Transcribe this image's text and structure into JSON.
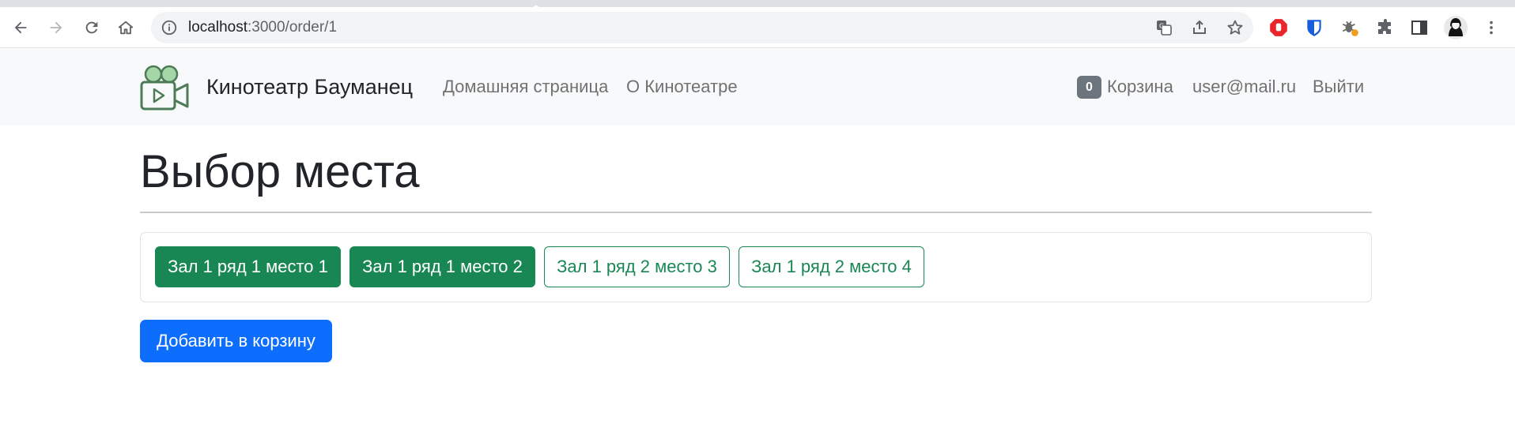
{
  "browser": {
    "url_host": "localhost",
    "url_path": ":3000/order/1"
  },
  "navbar": {
    "brand": "Кинотеатр Бауманец",
    "links": [
      "Домашняя страница",
      "О Кинотеатре"
    ],
    "cart_count": "0",
    "cart_label": "Корзина",
    "user_email": "user@mail.ru",
    "logout_label": "Выйти"
  },
  "page": {
    "title": "Выбор места",
    "seats": [
      {
        "label": "Зал 1 ряд 1 место 1",
        "selected": true
      },
      {
        "label": "Зал 1 ряд 1 место 2",
        "selected": true
      },
      {
        "label": "Зал 1 ряд 2 место 3",
        "selected": false
      },
      {
        "label": "Зал 1 ряд 2 место 4",
        "selected": false
      }
    ],
    "add_to_cart_label": "Добавить в корзину"
  },
  "colors": {
    "success": "#198754",
    "primary": "#0d6efd",
    "badge": "#6c757d",
    "navbar_bg": "#f8f9fa"
  },
  "icons": [
    "back-icon",
    "forward-icon",
    "reload-icon",
    "home-icon",
    "info-icon",
    "translate-icon",
    "share-icon",
    "bookmark-star-icon",
    "adblock-extension-icon",
    "bitwarden-extension-icon",
    "bug-extension-icon",
    "extensions-puzzle-icon",
    "side-panel-icon",
    "profile-avatar",
    "menu-kebab-icon",
    "movie-camera-logo"
  ]
}
